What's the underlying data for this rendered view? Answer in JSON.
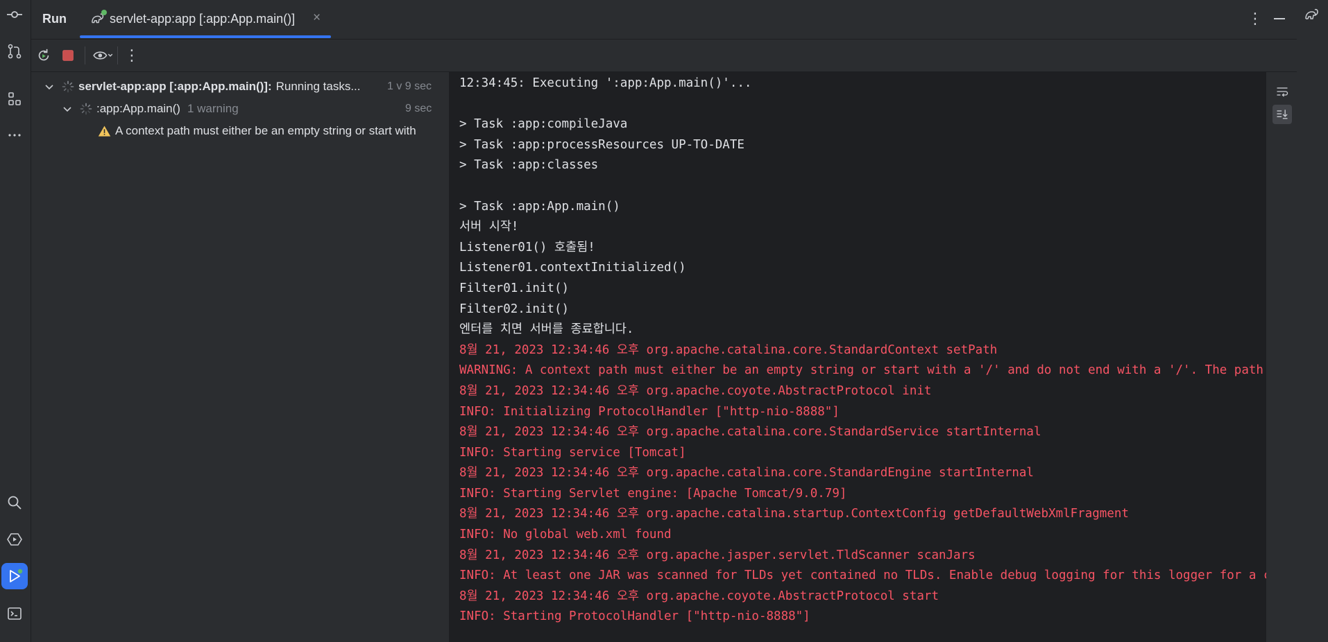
{
  "run_panel": {
    "title": "Run",
    "tab": {
      "label": "servlet-app:app [:app:App.main()]"
    }
  },
  "tree": {
    "root": {
      "name": "servlet-app:app [:app:App.main()]:",
      "status": "Running tasks...",
      "duration": "1 v 9 sec"
    },
    "child": {
      "name": ":app:App.main()",
      "note": "1 warning",
      "duration": "9 sec"
    },
    "warning": {
      "text": "A context path must either be an empty string or start with"
    }
  },
  "console": {
    "lines": [
      {
        "text": "12:34:45: Executing ':app:App.main()'...",
        "kind": "normal"
      },
      {
        "text": "",
        "kind": "normal"
      },
      {
        "text": "> Task :app:compileJava",
        "kind": "normal"
      },
      {
        "text": "> Task :app:processResources UP-TO-DATE",
        "kind": "normal"
      },
      {
        "text": "> Task :app:classes",
        "kind": "normal"
      },
      {
        "text": "",
        "kind": "normal"
      },
      {
        "text": "> Task :app:App.main()",
        "kind": "normal"
      },
      {
        "text": "서버 시작!",
        "kind": "normal"
      },
      {
        "text": "Listener01() 호출됨!",
        "kind": "normal"
      },
      {
        "text": "Listener01.contextInitialized()",
        "kind": "normal"
      },
      {
        "text": "Filter01.init()",
        "kind": "normal"
      },
      {
        "text": "Filter02.init()",
        "kind": "normal"
      },
      {
        "text": "엔터를 치면 서버를 종료합니다.",
        "kind": "normal"
      },
      {
        "text": "8월 21, 2023 12:34:46 오후 org.apache.catalina.core.StandardContext setPath",
        "kind": "err"
      },
      {
        "text": "WARNING: A context path must either be an empty string or start with a '/' and do not end with a '/'. The path [/] d",
        "kind": "err"
      },
      {
        "text": "8월 21, 2023 12:34:46 오후 org.apache.coyote.AbstractProtocol init",
        "kind": "err"
      },
      {
        "text": "INFO: Initializing ProtocolHandler [\"http-nio-8888\"]",
        "kind": "err"
      },
      {
        "text": "8월 21, 2023 12:34:46 오후 org.apache.catalina.core.StandardService startInternal",
        "kind": "err"
      },
      {
        "text": "INFO: Starting service [Tomcat]",
        "kind": "err"
      },
      {
        "text": "8월 21, 2023 12:34:46 오후 org.apache.catalina.core.StandardEngine startInternal",
        "kind": "err"
      },
      {
        "text": "INFO: Starting Servlet engine: [Apache Tomcat/9.0.79]",
        "kind": "err"
      },
      {
        "text": "8월 21, 2023 12:34:46 오후 org.apache.catalina.startup.ContextConfig getDefaultWebXmlFragment",
        "kind": "err"
      },
      {
        "text": "INFO: No global web.xml found",
        "kind": "err"
      },
      {
        "text": "8월 21, 2023 12:34:46 오후 org.apache.jasper.servlet.TldScanner scanJars",
        "kind": "err"
      },
      {
        "text": "INFO: At least one JAR was scanned for TLDs yet contained no TLDs. Enable debug logging for this logger for a comple",
        "kind": "err"
      },
      {
        "text": "8월 21, 2023 12:34:46 오후 org.apache.coyote.AbstractProtocol start",
        "kind": "err"
      },
      {
        "text": "INFO: Starting ProtocolHandler [\"http-nio-8888\"]",
        "kind": "err"
      }
    ]
  },
  "colors": {
    "accent": "#3574f0",
    "error_text": "#f75464",
    "warning_icon": "#f2c55c",
    "running_dot": "#5fb865"
  }
}
